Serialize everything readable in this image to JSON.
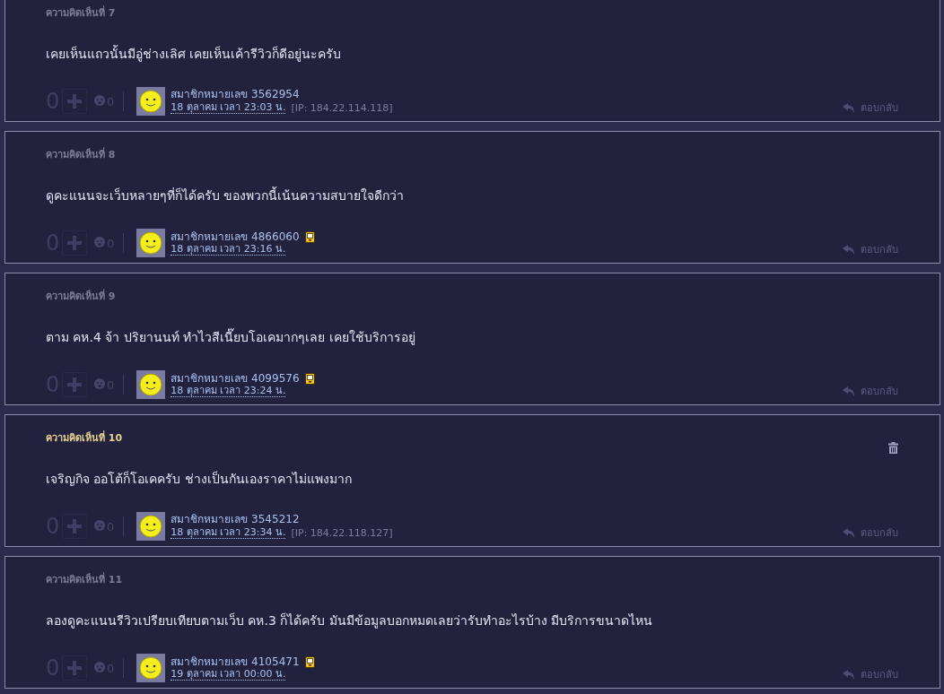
{
  "comments": [
    {
      "label": "ความคิดเห็นที่ 7",
      "highlighted": false,
      "deletable": false,
      "body": "เคยเห็นแถวนั้นมีอู่ช่างเลิศ เคยเห็นเค้ารีวิวก็ดีอยู่นะครับ",
      "votes": "0",
      "emotions": "0",
      "user": "สมาชิกหมายเลข 3562954",
      "mobile": false,
      "date": "18 ตุลาคม เวลา 23:03 น.",
      "ip": "[IP: 184.22.114.118]",
      "reply": "ตอบกลับ"
    },
    {
      "label": "ความคิดเห็นที่ 8",
      "highlighted": false,
      "deletable": false,
      "body": "ดูคะแนนจะเว็บหลายๆที่ก็ได้ครับ ของพวกนี้เน้นความสบายใจดีกว่า",
      "votes": "0",
      "emotions": "0",
      "user": "สมาชิกหมายเลข 4866060",
      "mobile": true,
      "date": "18 ตุลาคม เวลา 23:16 น.",
      "reply": "ตอบกลับ"
    },
    {
      "label": "ความคิดเห็นที่ 9",
      "highlighted": false,
      "deletable": false,
      "body": "ตาม คห.4 จ้า ปริยานนท์ ทำไวสีเนี๊ยบโอเคมากๆเลย เคยใช้บริการอยู่",
      "votes": "0",
      "emotions": "0",
      "user": "สมาชิกหมายเลข 4099576",
      "mobile": true,
      "date": "18 ตุลาคม เวลา 23:24 น.",
      "reply": "ตอบกลับ"
    },
    {
      "label": "ความคิดเห็นที่ 10",
      "highlighted": true,
      "deletable": true,
      "body": "เจริญกิจ ออโต้ก็โอเคครับ ช่างเป็นกันเองราคาไม่แพงมาก",
      "votes": "0",
      "emotions": "0",
      "user": "สมาชิกหมายเลข 3545212",
      "mobile": false,
      "date": "18 ตุลาคม เวลา 23:34 น.",
      "ip": "[IP: 184.22.118.127]",
      "reply": "ตอบกลับ"
    },
    {
      "label": "ความคิดเห็นที่ 11",
      "highlighted": false,
      "deletable": false,
      "body": "ลองดูคะแนนรีวิวเปรียบเทียบตามเว็บ คห.3 ก็ได้ครับ มันมีข้อมูลบอกหมดเลยว่ารับทำอะไรบ้าง มีบริการขนาดไหน",
      "votes": "0",
      "emotions": "0",
      "user": "สมาชิกหมายเลข 4105471",
      "mobile": true,
      "date": "19 ตุลาคม เวลา 00:00 น.",
      "reply": "ตอบกลับ"
    }
  ]
}
